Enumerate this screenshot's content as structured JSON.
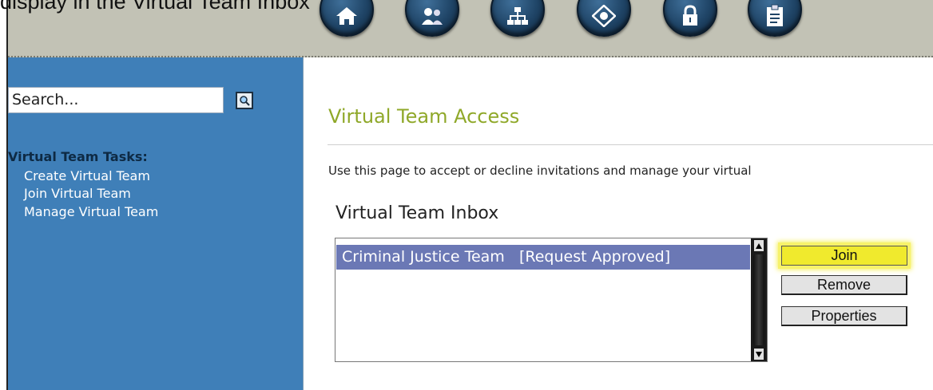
{
  "caption": "display in the Virtual Team Inbox",
  "nav": {
    "icons": [
      "home-icon",
      "people-icon",
      "hierarchy-icon",
      "compass-icon",
      "lock-icon",
      "clipboard-icon"
    ]
  },
  "sidebar": {
    "search_value": "Search...",
    "tasks_title": "Virtual Team Tasks:",
    "tasks": [
      "Create Virtual Team",
      "Join Virtual Team",
      "Manage Virtual Team"
    ]
  },
  "main": {
    "title": "Virtual Team Access",
    "intro": "Use this page to accept or decline invitations and manage your virtual",
    "inbox_label": "Virtual Team Inbox",
    "inbox_items": [
      {
        "team": "Criminal Justice Team",
        "status": "[Request Approved]"
      }
    ],
    "buttons": {
      "join": "Join",
      "remove": "Remove",
      "properties": "Properties"
    }
  },
  "colors": {
    "sidebar_bg": "#3f7fb8",
    "title_green": "#8fa829",
    "highlight_yellow": "#f0ea2d",
    "selected_row": "#6b78b5"
  }
}
